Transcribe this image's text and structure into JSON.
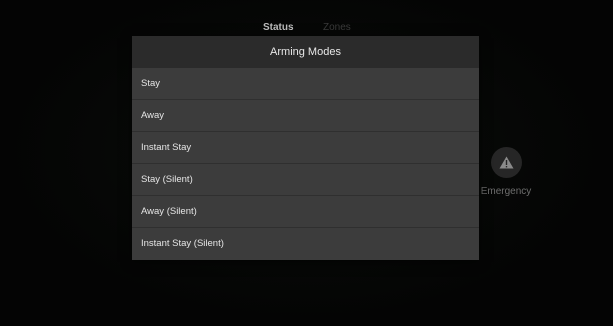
{
  "tabs": [
    {
      "label": "Status"
    },
    {
      "label": "Zones"
    }
  ],
  "emergency": {
    "label": "Emergency",
    "icon": "warning-triangle-icon"
  },
  "modal": {
    "title": "Arming Modes",
    "options": [
      {
        "label": "Stay"
      },
      {
        "label": "Away"
      },
      {
        "label": "Instant Stay"
      },
      {
        "label": "Stay (Silent)"
      },
      {
        "label": "Away (Silent)"
      },
      {
        "label": "Instant Stay (Silent)"
      }
    ]
  },
  "colors": {
    "background": "#050505",
    "modal_body": "#3c3c3c",
    "modal_header": "#2b2b2b",
    "text": "#e6e6e6"
  }
}
